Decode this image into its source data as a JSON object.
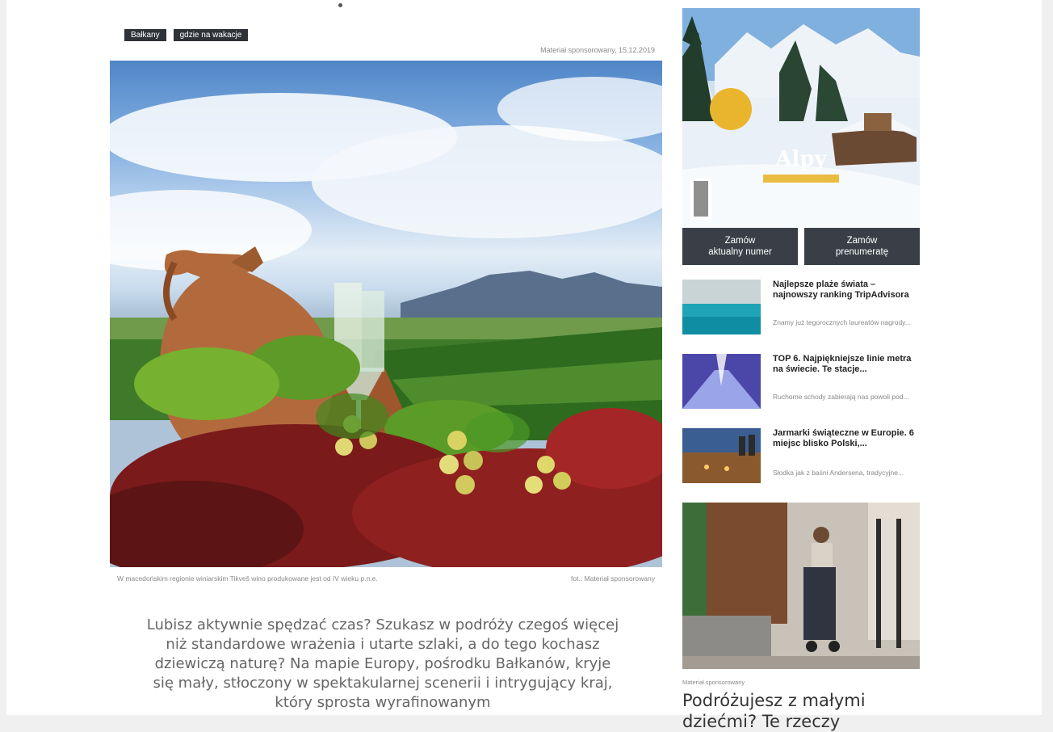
{
  "article": {
    "tags": [
      "Bałkany",
      "gdzie na wakacje"
    ],
    "meta": "Materiał sponsorowany, 15.12.2019",
    "image_caption": "W macedońskim regionie winiarskim Tikveš wino produkowane jest od IV wieku p.n.e.",
    "image_credit": "fot.: Materiał sponsorowany",
    "lead": "Lubisz aktywnie spędzać czas? Szukasz w podróży czegoś więcej niż standardowe wrażenia i utarte szlaki, a do tego kochasz dziewiczą naturę? Na mapie Europy, pośrodku Bałkanów, kryje się mały, stłoczony w spektakularnej scenerii i intrygujący kraj, który sprosta wyrafinowanym"
  },
  "sidebar": {
    "magazine": {
      "title": "Alpy",
      "buttons": [
        {
          "line1": "Zamów",
          "line2": "aktualny numer"
        },
        {
          "line1": "Zamów",
          "line2": "prenumeratę"
        }
      ]
    },
    "news": [
      {
        "title": "Najlepsze plaże świata – najnowszy ranking TripAdvisora",
        "desc": "Znamy już tegorocznych laureatów nagrody..."
      },
      {
        "title": "TOP 6. Najpiękniejsze linie metra na świecie. Te stacje...",
        "desc": "Ruchome schody zabierają nas powoli pod..."
      },
      {
        "title": "Jarmarki świąteczne w Europie. 6 miejsc blisko Polski,...",
        "desc": "Słodka jak z baśni Andersena, tradycyjne..."
      }
    ],
    "promo": {
      "label": "Materiał sponsorowany",
      "title": "Podróżujesz z małymi dziećmi? Te rzeczy"
    }
  },
  "colors": {
    "tag_bg": "#2f3338",
    "button_bg": "#3a3f47"
  }
}
